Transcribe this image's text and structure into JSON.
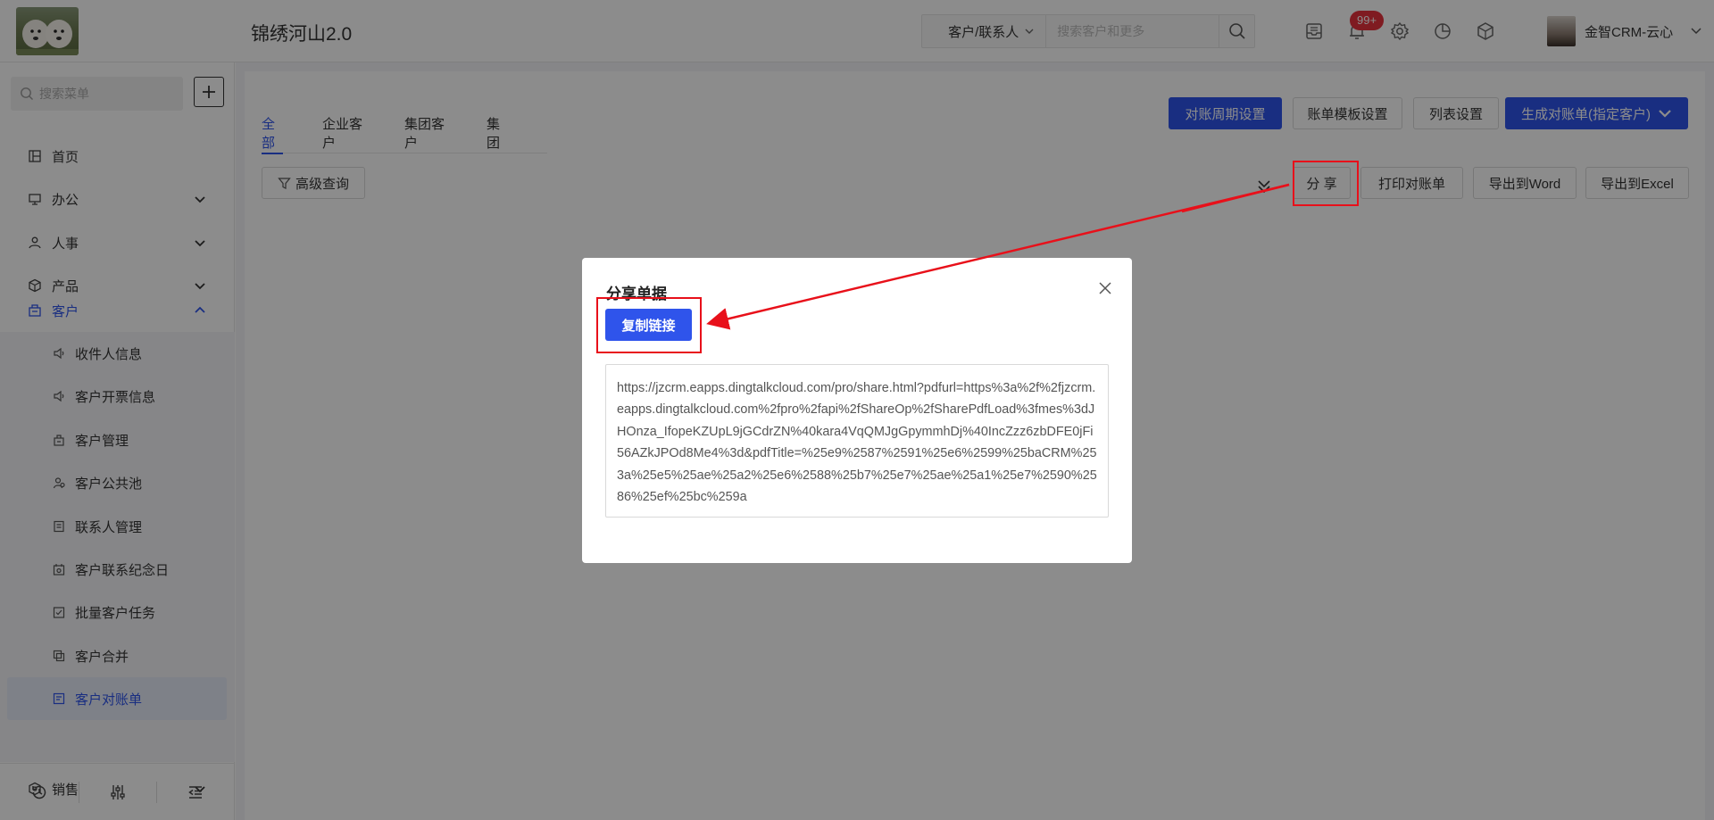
{
  "app": {
    "title": "锦绣河山2.0"
  },
  "header": {
    "search_type": "客户/联系人",
    "search_placeholder": "搜索客户和更多",
    "notification_badge": "99+",
    "user_name": "金智CRM-云心"
  },
  "sidebar": {
    "search_placeholder": "搜索菜单",
    "items": [
      {
        "label": "首页",
        "icon": "home-icon"
      },
      {
        "label": "办公",
        "icon": "office-icon"
      },
      {
        "label": "人事",
        "icon": "hr-icon"
      },
      {
        "label": "产品",
        "icon": "product-icon"
      },
      {
        "label": "客户",
        "icon": "customer-icon"
      },
      {
        "label": "销售",
        "icon": "sales-icon"
      }
    ],
    "sub_items": [
      {
        "label": "收件人信息",
        "icon": "speaker-icon"
      },
      {
        "label": "客户开票信息",
        "icon": "speaker-icon"
      },
      {
        "label": "客户管理",
        "icon": "building-icon"
      },
      {
        "label": "客户公共池",
        "icon": "users-icon"
      },
      {
        "label": "联系人管理",
        "icon": "contact-card-icon"
      },
      {
        "label": "客户联系纪念日",
        "icon": "calendar-icon"
      },
      {
        "label": "批量客户任务",
        "icon": "task-icon"
      },
      {
        "label": "客户合并",
        "icon": "merge-icon"
      },
      {
        "label": "客户对账单",
        "icon": "statement-icon"
      }
    ]
  },
  "main": {
    "tabs": [
      "全部",
      "企业客户",
      "集团客户",
      "集团"
    ],
    "top_buttons": {
      "cycle": "对账周期设置",
      "template": "账单模板设置",
      "list": "列表设置",
      "generate": "生成对账单(指定客户)"
    },
    "advanced_query": "高级查询",
    "action_buttons": {
      "share": "分 享",
      "print": "打印对账单",
      "export_word": "导出到Word",
      "export_excel": "导出到Excel"
    }
  },
  "modal": {
    "title": "分享单据",
    "copy_button": "复制链接",
    "link": "https://jzcrm.eapps.dingtalkcloud.com/pro/share.html?pdfurl=https%3a%2f%2fjzcrm.eapps.dingtalkcloud.com%2fpro%2fapi%2fShareOp%2fSharePdfLoad%3fmes%3dJHOnza_IfopeKZUpL9jGCdrZN%40kara4VqQMJgGpymmhDj%40IncZzz6zbDFE0jFi56AZkJPOd8Me4%3d&pdfTitle=%25e9%2587%2591%25e6%2599%25baCRM%253a%25e5%25ae%25a2%25e6%2588%25b7%25e7%25ae%25a1%25e7%2590%2586%25ef%25bc%259a"
  },
  "colors": {
    "primary": "#2f54eb",
    "annotation_red": "#e8101a",
    "badge_red": "#e8323c"
  }
}
